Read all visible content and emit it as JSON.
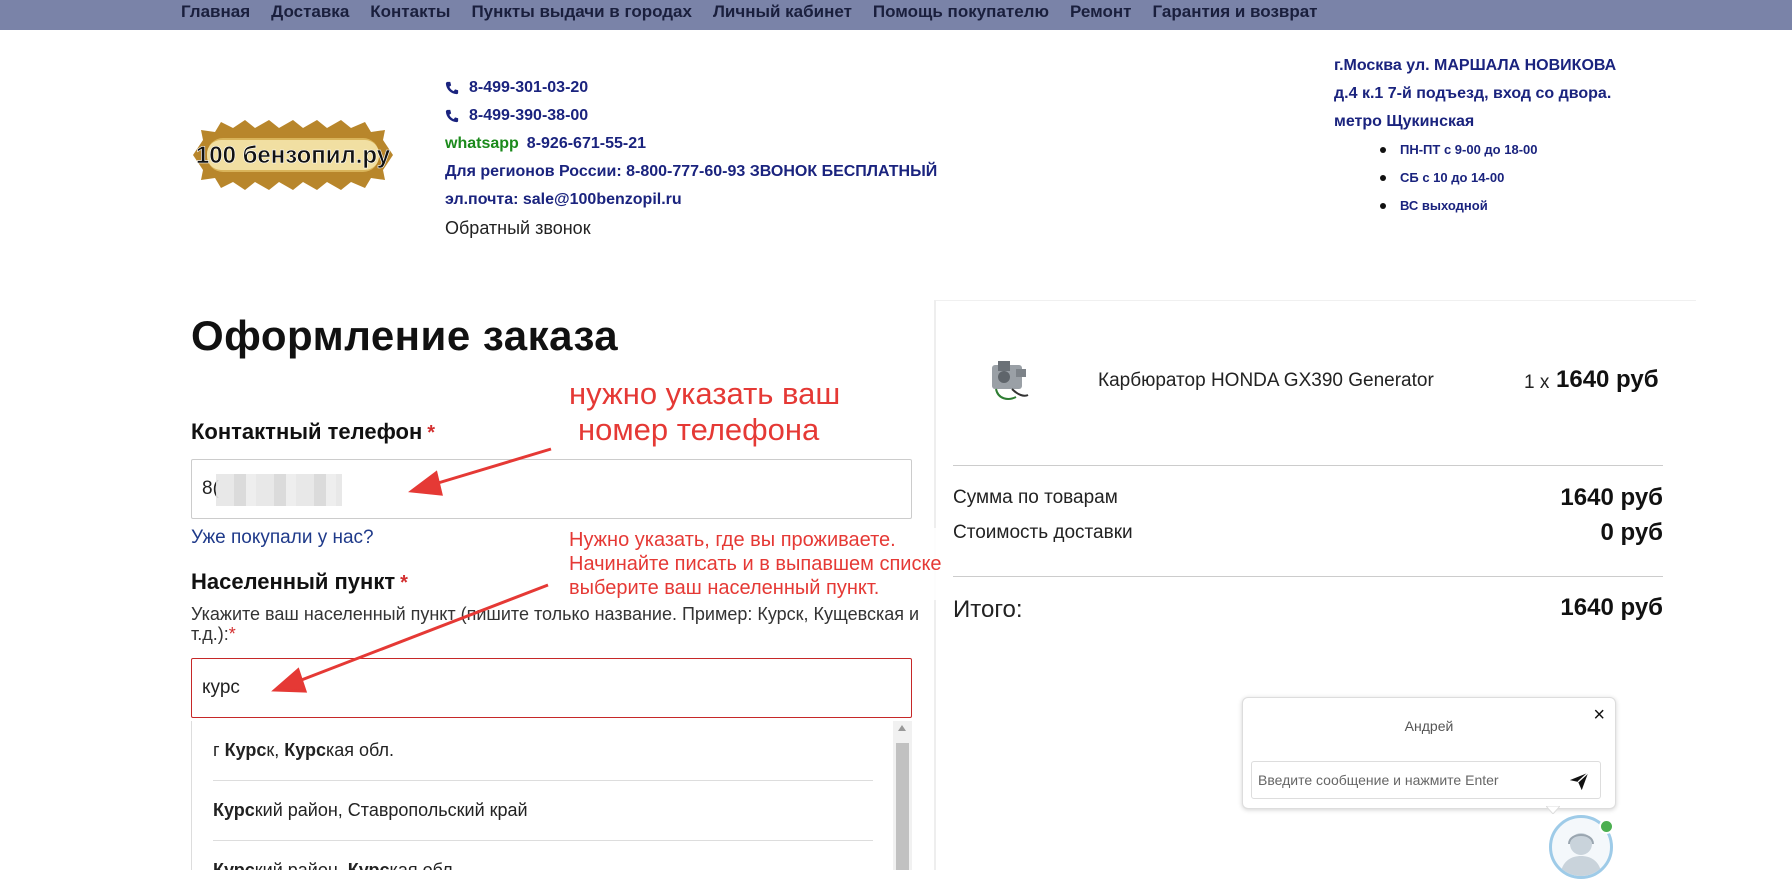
{
  "nav": [
    "Главная",
    "Доставка",
    "Контакты",
    "Пункты выдачи в городах",
    "Личный кабинет",
    "Помощь покупателю",
    "Ремонт",
    "Гарантия и возврат"
  ],
  "logo": {
    "text": "100 бензопил.ру"
  },
  "contacts": {
    "phone1": "8-499-301-03-20",
    "phone2": "8-499-390-38-00",
    "whatsapp_label": "whatsapp",
    "whatsapp_number": "8-926-671-55-21",
    "regions": "Для регионов России: 8-800-777-60-93 ЗВОНОК БЕСПЛАТНЫЙ",
    "email": "эл.почта: sale@100benzopil.ru",
    "callback": "Обратный звонок"
  },
  "address": {
    "line1": "г.Москва ул. МАРШАЛА НОВИКОВА",
    "line2": "д.4 к.1  7-й подъезд, вход со двора.",
    "line3": "метро Щукинская",
    "hours": [
      "ПН-ПТ с 9-00 до 18-00",
      "СБ с 10 до 14-00",
      "ВС выходной"
    ]
  },
  "form": {
    "title": "Оформление заказа",
    "phone_label": "Контактный телефон",
    "required_mark": "*",
    "phone_value": "8(",
    "bought_link": "Уже покупали у нас?",
    "city_label": "Населенный пункт",
    "city_hint": "Укажите ваш населенный пункт (пишите только название. Пример: Курск, Кущевская и т.д.):",
    "city_value": "курс",
    "suggestions": [
      {
        "bold1": "Курс",
        "rest1": "к, ",
        "bold2": "Курс",
        "rest2": "кая обл.",
        "prefix": "г "
      },
      {
        "bold1": "Курс",
        "rest1": "кий район, Ставропольский край",
        "bold2": "",
        "rest2": "",
        "prefix": ""
      },
      {
        "bold1": "Курс",
        "rest1": "кий район, ",
        "bold2": "Курс",
        "rest2": "кая обл.",
        "prefix": ""
      }
    ]
  },
  "annotations": {
    "phone_note_1": "нужно указать ваш",
    "phone_note_2": "номер телефона",
    "city_note_1": "Нужно указать, где вы проживаете.",
    "city_note_2": "Начинайте писать и в выпавшем списке",
    "city_note_3": "выберите ваш населенный пункт."
  },
  "cart": {
    "product_name": "Карбюратор HONDA GX390 Generator",
    "qty": "1 x",
    "price": "1640 руб",
    "subtotal_label": "Сумма по товарам",
    "subtotal_value": "1640 руб",
    "delivery_label": "Стоимость доставки",
    "delivery_value": "0 руб",
    "total_label": "Итого:",
    "total_value": "1640 руб"
  },
  "chat": {
    "agent_name": "Андрей",
    "placeholder": "Введите сообщение и нажмите Enter",
    "close": "×"
  },
  "colors": {
    "nav_bg": "#7a83a8",
    "link": "#1a237e",
    "error": "#c62828",
    "annotation": "#e53935"
  }
}
